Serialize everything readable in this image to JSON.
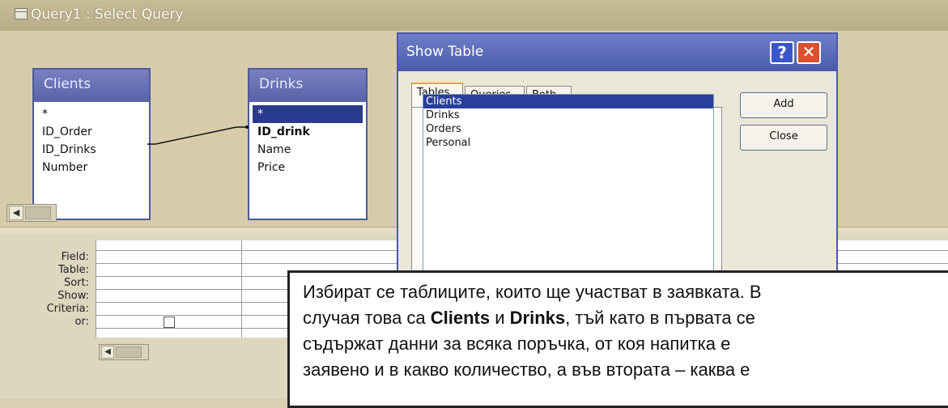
{
  "window": {
    "title": "Query1 : Select Query"
  },
  "tables": [
    {
      "name": "Clients",
      "fields": [
        "*",
        "ID_Order",
        "ID_Drinks",
        "Number"
      ]
    },
    {
      "name": "Drinks",
      "fields": [
        "*",
        "ID_drink",
        "Name",
        "Price"
      ]
    }
  ],
  "grid": {
    "row_labels": [
      "Field:",
      "Table:",
      "Sort:",
      "Show:",
      "Criteria:",
      "or:"
    ]
  },
  "dialog": {
    "title": "Show Table",
    "help_label": "?",
    "close_label": "✕",
    "tabs": [
      "Tables",
      "Queries",
      "Both"
    ],
    "list": [
      "Clients",
      "Drinks",
      "Orders",
      "Personal"
    ],
    "selected": "Clients",
    "add_label": "Add",
    "close_button_label": "Close"
  },
  "callout": {
    "part1": "Избират се таблиците, които ще участват в заявката. В",
    "part2": "случая това са ",
    "bold1": "Clients",
    "part3": " и ",
    "bold2": "Drinks",
    "part4": ", тъй като в първата се",
    "part5": "съдържат данни за всяка поръчка, от коя напитка е",
    "part6": "заявено и в какво количество, а във втората – каква е"
  },
  "colors": {
    "titlebar": "#b9ad88",
    "dialog_title": "#4a5bab",
    "selection": "#2a3f9c",
    "table_header": "#5963a8"
  }
}
